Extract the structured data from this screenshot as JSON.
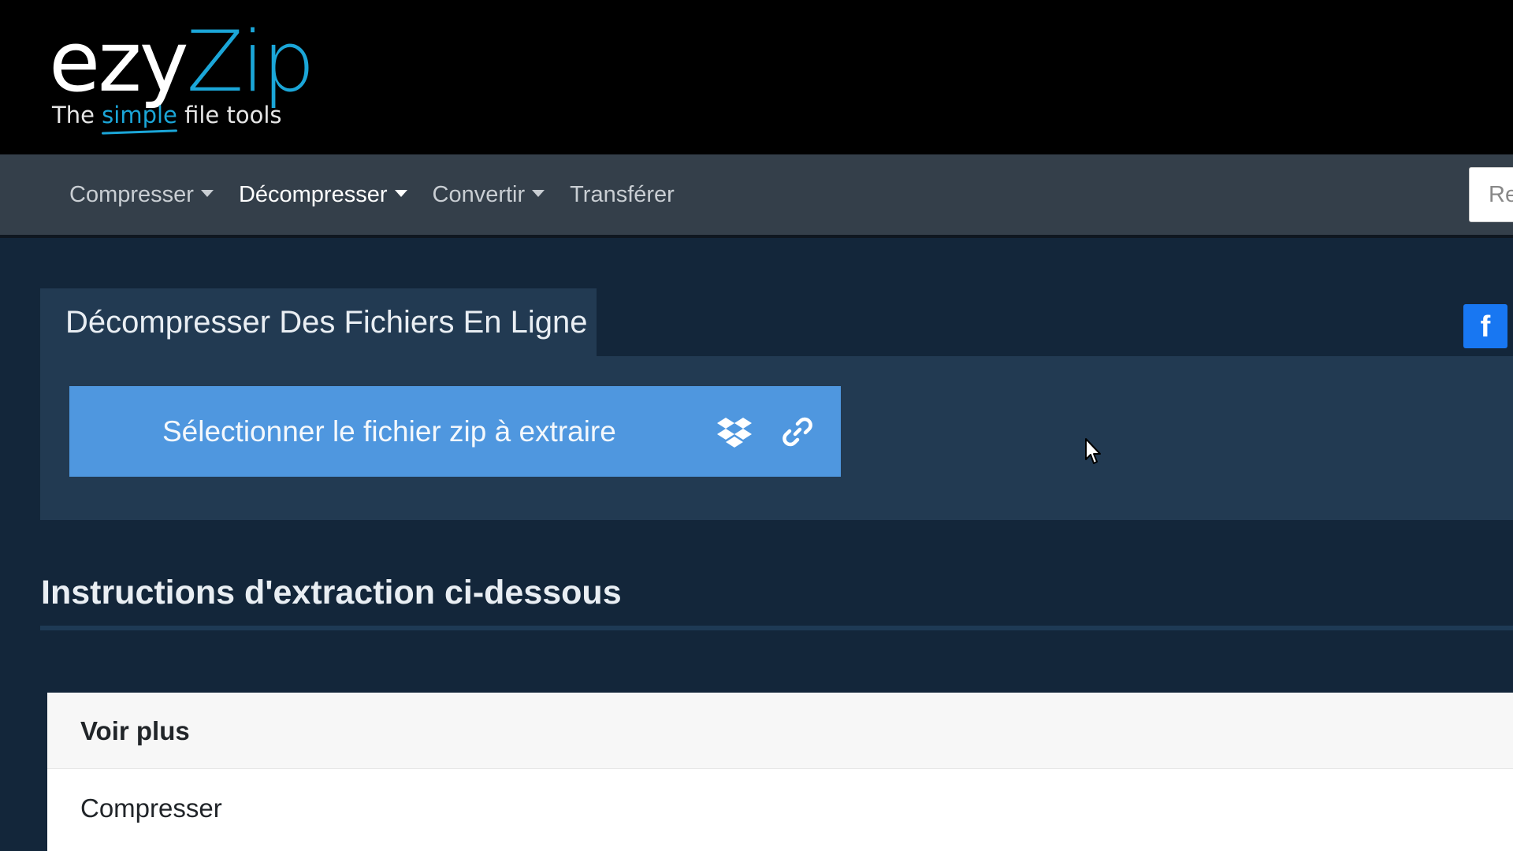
{
  "brand": {
    "logo_part1": "ezy",
    "logo_part2": "Zip",
    "tagline_before": "The",
    "tagline_highlight": "simple",
    "tagline_after": "file tools",
    "accent_color": "#1ba6d8"
  },
  "navbar": {
    "items": [
      {
        "label": "Compresser",
        "dropdown": true,
        "active": false
      },
      {
        "label": "Décompresser",
        "dropdown": true,
        "active": true
      },
      {
        "label": "Convertir",
        "dropdown": true,
        "active": false
      },
      {
        "label": "Transférer",
        "dropdown": false,
        "active": false
      }
    ],
    "search_value": "Re"
  },
  "main": {
    "tab_title": "Décompresser Des Fichiers En Ligne",
    "select_button_label": "Sélectionner le fichier zip à extraire",
    "select_button_color": "#4f97df",
    "icons": [
      "dropbox-icon",
      "link-icon"
    ],
    "share_button": {
      "label": "f",
      "icon": "facebook-icon",
      "color": "#1877f2"
    }
  },
  "instructions": {
    "heading": "Instructions d'extraction ci-dessous"
  },
  "more_panel": {
    "title": "Voir plus",
    "links": [
      "Compresser"
    ]
  }
}
